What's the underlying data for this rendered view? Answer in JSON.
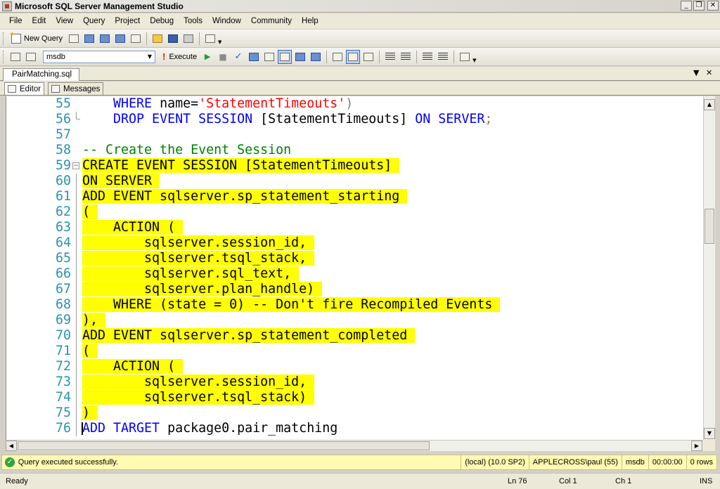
{
  "window": {
    "title": "Microsoft SQL Server Management Studio"
  },
  "menu": [
    "File",
    "Edit",
    "View",
    "Query",
    "Project",
    "Debug",
    "Tools",
    "Window",
    "Community",
    "Help"
  ],
  "toolbar1": {
    "new_query_label": "New Query"
  },
  "toolbar2": {
    "database": "msdb",
    "execute_label": "Execute"
  },
  "document_tab": {
    "label": "PairMatching.sql"
  },
  "result_tabs": {
    "editor": "Editor",
    "messages": "Messages"
  },
  "editor": {
    "lines": [
      {
        "num": "55",
        "segments": [
          [
            "",
            "    "
          ],
          [
            "kw",
            "WHERE "
          ],
          [
            "",
            "name="
          ],
          [
            "str",
            "'StatementTimeouts'"
          ],
          [
            "gr",
            ")"
          ]
        ]
      },
      {
        "num": "56",
        "segments": [
          [
            "",
            "    "
          ],
          [
            "kw",
            "DROP EVENT SESSION "
          ],
          [
            "",
            "[StatementTimeouts] "
          ],
          [
            "kw",
            "ON SERVER"
          ],
          [
            "gr",
            ";"
          ]
        ]
      },
      {
        "num": "57",
        "segments": []
      },
      {
        "num": "58",
        "segments": [
          [
            "cm",
            "-- Create the Event Session"
          ]
        ]
      },
      {
        "num": "59",
        "segments": [
          [
            "hl",
            "CREATE EVENT SESSION [StatementTimeouts] "
          ]
        ]
      },
      {
        "num": "60",
        "segments": [
          [
            "hl",
            "ON SERVER "
          ]
        ]
      },
      {
        "num": "61",
        "segments": [
          [
            "hl",
            "ADD EVENT sqlserver.sp_statement_starting "
          ]
        ]
      },
      {
        "num": "62",
        "segments": [
          [
            "hl",
            "( "
          ]
        ]
      },
      {
        "num": "63",
        "segments": [
          [
            "hl",
            "    ACTION ( "
          ]
        ]
      },
      {
        "num": "64",
        "segments": [
          [
            "hl",
            "        sqlserver.session_id, "
          ]
        ]
      },
      {
        "num": "65",
        "segments": [
          [
            "hl",
            "        sqlserver.tsql_stack, "
          ]
        ]
      },
      {
        "num": "66",
        "segments": [
          [
            "hl",
            "        sqlserver.sql_text, "
          ]
        ]
      },
      {
        "num": "67",
        "segments": [
          [
            "hl",
            "        sqlserver.plan_handle) "
          ]
        ]
      },
      {
        "num": "68",
        "segments": [
          [
            "hl",
            "    WHERE (state = 0) -- Don't fire Recompiled Events "
          ]
        ]
      },
      {
        "num": "69",
        "segments": [
          [
            "hl",
            "), "
          ]
        ]
      },
      {
        "num": "70",
        "segments": [
          [
            "hl",
            "ADD EVENT sqlserver.sp_statement_completed "
          ]
        ]
      },
      {
        "num": "71",
        "segments": [
          [
            "hl",
            "( "
          ]
        ]
      },
      {
        "num": "72",
        "segments": [
          [
            "hl",
            "    ACTION ( "
          ]
        ]
      },
      {
        "num": "73",
        "segments": [
          [
            "hl",
            "        sqlserver.session_id, "
          ]
        ]
      },
      {
        "num": "74",
        "segments": [
          [
            "hl",
            "        sqlserver.tsql_stack) "
          ]
        ]
      },
      {
        "num": "75",
        "segments": [
          [
            "hl",
            ") "
          ]
        ]
      },
      {
        "num": "76",
        "segments": [
          [
            "kw",
            "ADD TARGET "
          ],
          [
            "",
            "package0.pair_matching"
          ]
        ]
      }
    ]
  },
  "query_status": {
    "message": "Query executed successfully.",
    "server": "(local) (10.0 SP2)",
    "user": "APPLECROSS\\paul (55)",
    "database": "msdb",
    "elapsed": "00:00:00",
    "rows": "0 rows"
  },
  "status_bar": {
    "state": "Ready",
    "line": "Ln 76",
    "col": "Col 1",
    "ch": "Ch 1",
    "mode": "INS"
  }
}
